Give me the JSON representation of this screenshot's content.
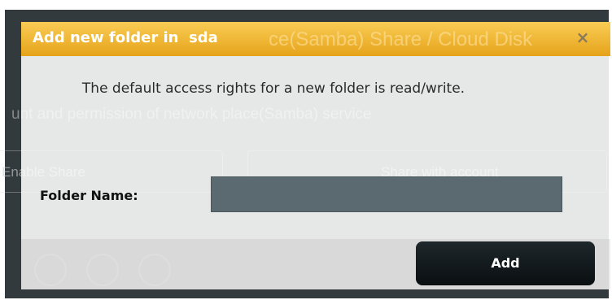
{
  "background_page": {
    "title_fragment": "ce(Samba) Share / Cloud Disk",
    "description_fragment": "unt and permission of network place(Samba) service",
    "col_enable_share": "Enable Share",
    "col_share_with_account": "Share with account"
  },
  "dialog": {
    "title": "Add new folder in  sda",
    "close_glyph": "×",
    "message": "The default access rights for a new folder is read/write.",
    "folder_name_label": "Folder Name:",
    "folder_name_value": "",
    "add_button_label": "Add"
  },
  "colors": {
    "header_accent": "#e6a31a",
    "frame_background": "#323a3d",
    "input_background": "#5b6a70",
    "button_background": "#0a0f11"
  }
}
